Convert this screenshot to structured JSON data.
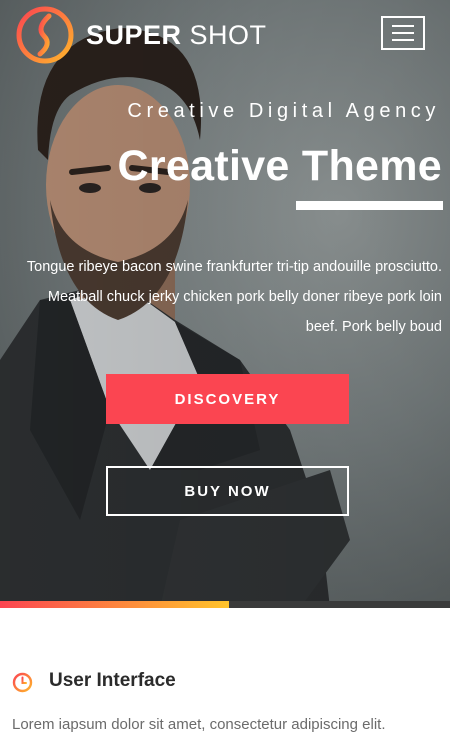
{
  "header": {
    "logo_bold": "SUPER",
    "logo_light": "SHOT",
    "logo_icon": "flame-swirl-logo",
    "menu_icon": "hamburger-icon"
  },
  "hero": {
    "eyebrow": "Creative Digital Agency",
    "headline": "Creative Theme",
    "blurb": "Tongue ribeye bacon swine frankfurter tri-tip andouille prosciutto. Meatball chuck jerky chicken pork belly doner ribeye pork loin beef. Pork belly boud",
    "primary_button": "DISCOVERY",
    "secondary_button": "BUY NOW"
  },
  "feature": {
    "icon": "clock-icon",
    "title": "User Interface",
    "text": "Lorem iapsum dolor sit amet, consectetur adipiscing elit."
  },
  "colors": {
    "accent": "#fb4551",
    "accent_orange": "#fd8a3c",
    "accent_yellow": "#ffc42b",
    "dark_strip": "#3a3b3b",
    "heading": "#2b2b2b",
    "body_text": "#6b6b6b"
  }
}
